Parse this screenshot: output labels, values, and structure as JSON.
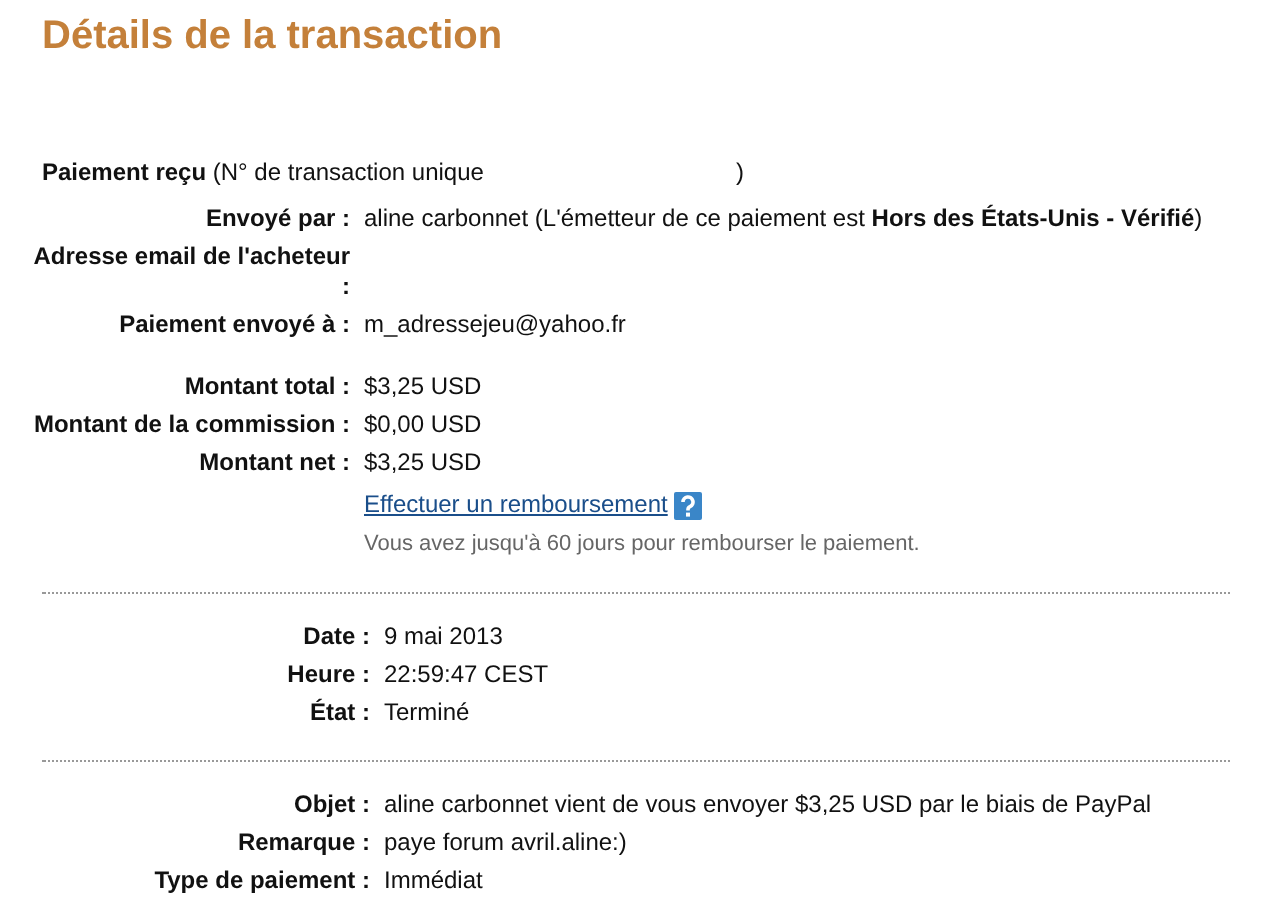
{
  "title": "Détails de la transaction",
  "header": {
    "text": "**Paiement reçu** (N° de transaction unique",
    "close": ")"
  },
  "sections": [
    {
      "groups": [
        [
          {
            "label": "Envoyé par :",
            "value": "aline carbonnet (L'émetteur de ce paiement est **Hors des États-Unis - Vérifié**)"
          },
          {
            "label": "Adresse email de l'acheteur :"
          },
          {
            "label": "Paiement envoyé à :",
            "value": "m_adressejeu@yahoo.fr"
          }
        ],
        [
          {
            "label": "Montant total :",
            "value": "$3,25 USD"
          },
          {
            "label": "Montant de la commission :",
            "value": "$0,00 USD"
          },
          {
            "label": "Montant net :",
            "value": "$3,25 USD"
          }
        ]
      ],
      "refund": {
        "link": "Effectuer un remboursement",
        "note": "Vous avez jusqu'à 60 jours pour rembourser le paiement."
      }
    },
    {
      "groups": [
        [
          {
            "label": "Date :",
            "value": "9 mai 2013"
          },
          {
            "label": "Heure :",
            "value": "22:59:47 CEST"
          },
          {
            "label": "État :",
            "value": "Terminé"
          }
        ]
      ]
    },
    {
      "groups": [
        [
          {
            "label": "Objet :",
            "value": "aline carbonnet vient de vous envoyer $3,25 USD par le biais de PayPal"
          },
          {
            "label": "Remarque :",
            "value": "paye forum avril.aline:)"
          },
          {
            "label": "Type de paiement :",
            "value": "Immédiat"
          }
        ]
      ]
    }
  ]
}
